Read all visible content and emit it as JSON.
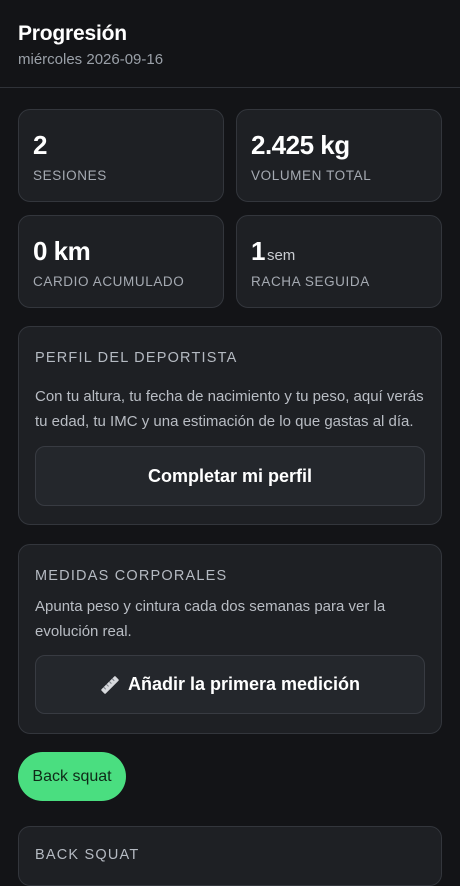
{
  "header": {
    "title": "Progresión",
    "date": "miércoles 2026-09-16"
  },
  "stats": [
    {
      "value": "2",
      "unit": "",
      "label": "SESIONES"
    },
    {
      "value": "2.425 kg",
      "unit": "",
      "label": "VOLUMEN TOTAL"
    },
    {
      "value": "0 km",
      "unit": "",
      "label": "CARDIO ACUMULADO"
    },
    {
      "value": "1",
      "unit": "sem",
      "label": "RACHA SEGUIDA"
    }
  ],
  "profile": {
    "title": "PERFIL DEL DEPORTISTA",
    "text": "Con tu altura, tu fecha de nacimiento y tu peso, aquí verás tu edad, tu IMC y una estimación de lo que gastas al día.",
    "button": "Completar mi perfil"
  },
  "measures": {
    "title": "MEDIDAS CORPORALES",
    "text": "Apunta peso y cintura cada dos semanas para ver la evolución real.",
    "button": "Añadir la primera medición",
    "button_icon": "ruler-icon"
  },
  "exercise_chip": "Back squat",
  "next_section": {
    "title": "BACK SQUAT"
  },
  "colors": {
    "accent": "#4ade80",
    "background": "#131417",
    "card": "#1e2024"
  }
}
